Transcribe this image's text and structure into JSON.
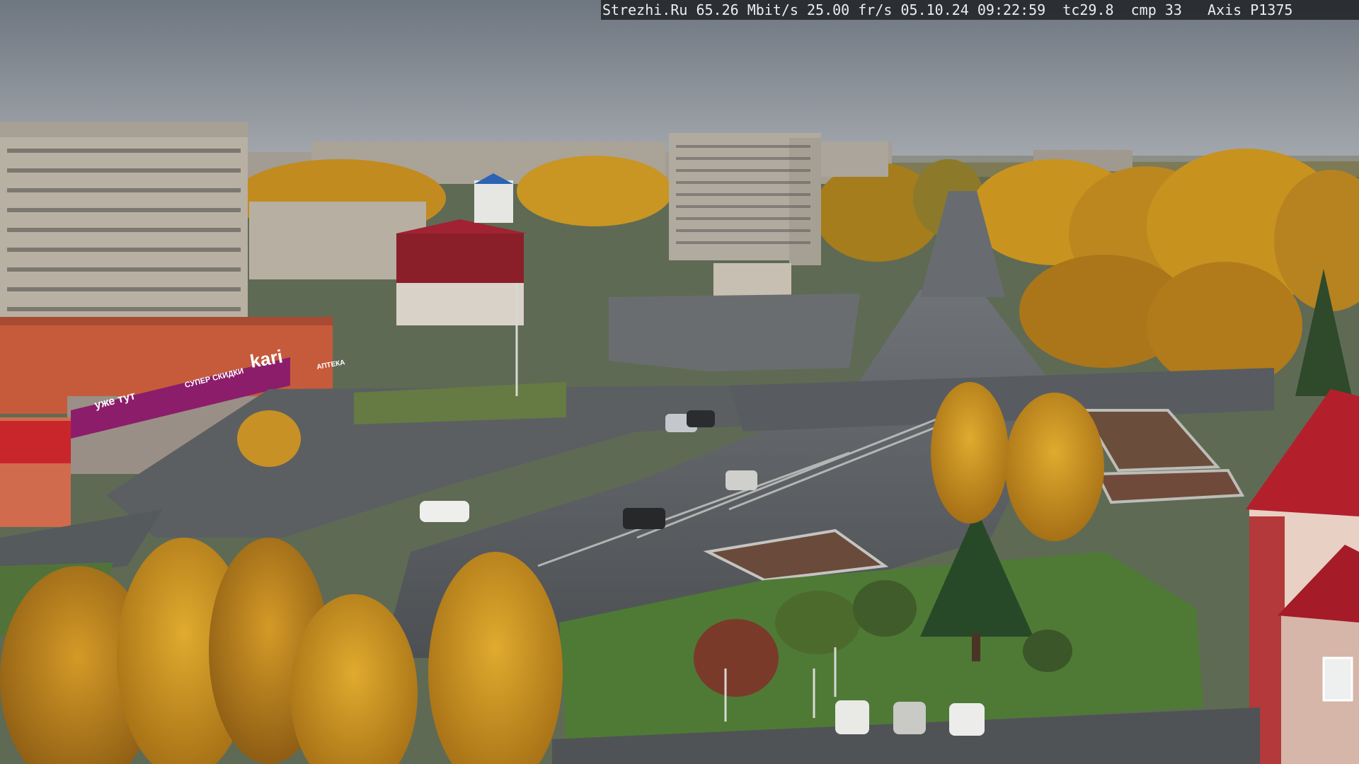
{
  "overlay": {
    "site": "Strezhi.Ru",
    "bitrate": "65.26 Mbit/s",
    "framerate": "25.00 fr/s",
    "date": "05.10.24",
    "time": "09:22:59",
    "tc": "tc29.8",
    "cmp": "cmp 33",
    "camera_model": "Axis P1375"
  },
  "signs": {
    "store_name": "kari",
    "store_facade": "уже тут",
    "store_slogan": "СУПЕР СКИДКИ",
    "pharmacy": "АПТЕКА"
  },
  "colors": {
    "sky": "#7b828b",
    "foliage": "#c8931f",
    "store_magenta": "#8c1d6a",
    "roof_red": "#b3202c"
  }
}
